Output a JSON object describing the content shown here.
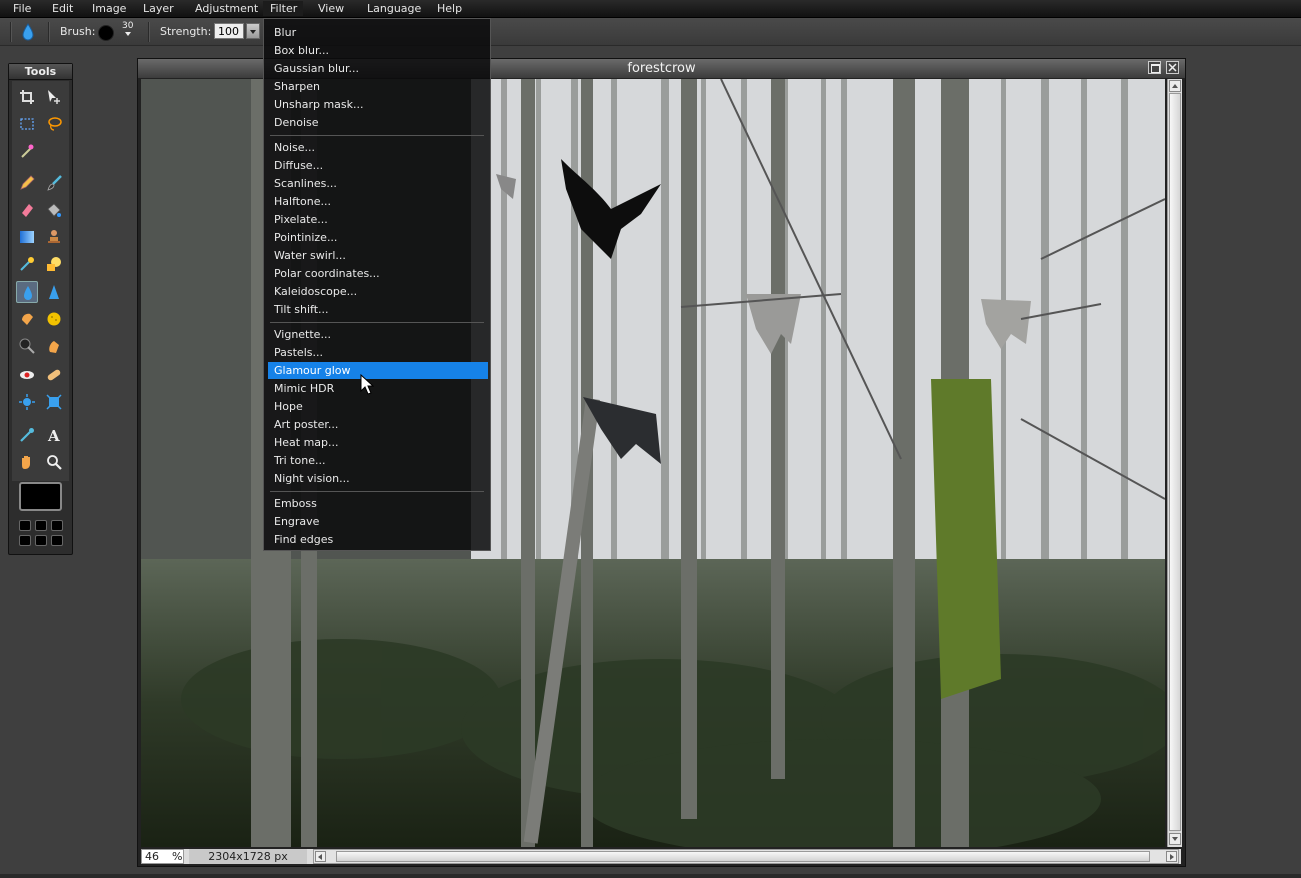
{
  "menubar": {
    "items": [
      "File",
      "Edit",
      "Image",
      "Layer",
      "Adjustment",
      "Filter",
      "View",
      "Language",
      "Help"
    ]
  },
  "options": {
    "brush_label": "Brush:",
    "brush_size": "30",
    "strength_label": "Strength:",
    "strength_value": "100"
  },
  "tools": {
    "title": "Tools"
  },
  "document": {
    "title": "forestcrow",
    "zoom": "46",
    "zoom_unit": "%",
    "dimensions": "2304x1728 px"
  },
  "filter_menu": {
    "groups": [
      [
        "Blur",
        "Box blur...",
        "Gaussian blur...",
        "Sharpen",
        "Unsharp mask...",
        "Denoise"
      ],
      [
        "Noise...",
        "Diffuse...",
        "Scanlines...",
        "Halftone...",
        "Pixelate...",
        "Pointinize...",
        "Water swirl...",
        "Polar coordinates...",
        "Kaleidoscope...",
        "Tilt shift..."
      ],
      [
        "Vignette...",
        "Pastels...",
        "Glamour glow",
        "Mimic HDR",
        "Hope",
        "Art poster...",
        "Heat map...",
        "Tri tone...",
        "Night vision..."
      ],
      [
        "Emboss",
        "Engrave",
        "Find edges"
      ]
    ],
    "highlighted": "Glamour glow"
  },
  "colors": {
    "highlight": "#1682e8",
    "menubar": "#1a1a1a",
    "workspace": "#3f3f3f"
  }
}
